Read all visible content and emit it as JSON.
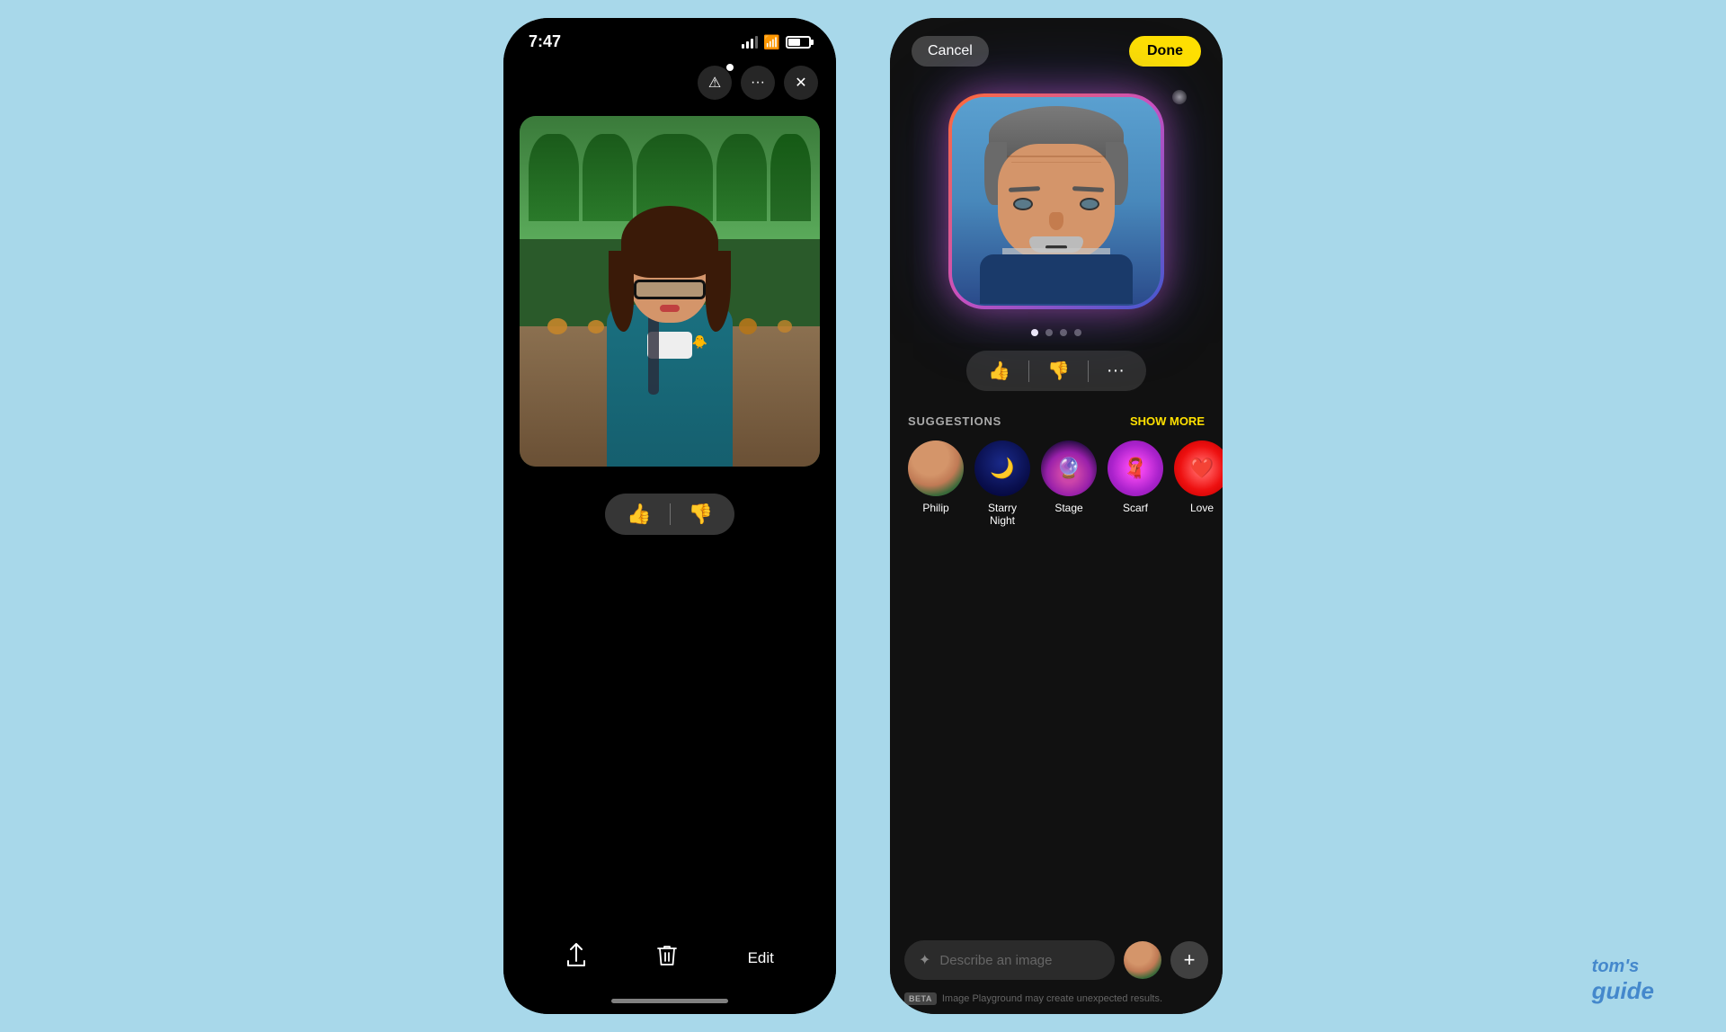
{
  "background": {
    "color": "#a8d8ea"
  },
  "phone1": {
    "status": {
      "time": "7:47"
    },
    "toolbar": {
      "report_label": "!",
      "more_label": "···",
      "close_label": "✕"
    },
    "feedback": {
      "like": "👍",
      "dislike": "👎"
    },
    "bottom": {
      "share": "share-icon",
      "delete": "trash-icon",
      "edit": "Edit"
    }
  },
  "phone2": {
    "header": {
      "cancel": "Cancel",
      "done": "Done"
    },
    "dots": [
      true,
      false,
      false,
      false
    ],
    "actions": {
      "like": "👍",
      "dislike": "👎",
      "more": "···"
    },
    "suggestions": {
      "title": "SUGGESTIONS",
      "show_more": "SHOW MORE",
      "items": [
        {
          "id": "philip",
          "label": "Philip",
          "emoji": "👤"
        },
        {
          "id": "starry-night",
          "label": "Starry Night",
          "emoji": "🌙"
        },
        {
          "id": "stage",
          "label": "Stage",
          "emoji": "🔮"
        },
        {
          "id": "scarf",
          "label": "Scarf",
          "emoji": "🧣"
        },
        {
          "id": "love",
          "label": "Love",
          "emoji": "❤️"
        }
      ]
    },
    "search": {
      "placeholder": "Describe an image"
    },
    "beta": {
      "badge": "BETA",
      "text": "Image Playground may create unexpected results."
    }
  },
  "watermark": {
    "line1": "tom's",
    "line2": "guide"
  }
}
